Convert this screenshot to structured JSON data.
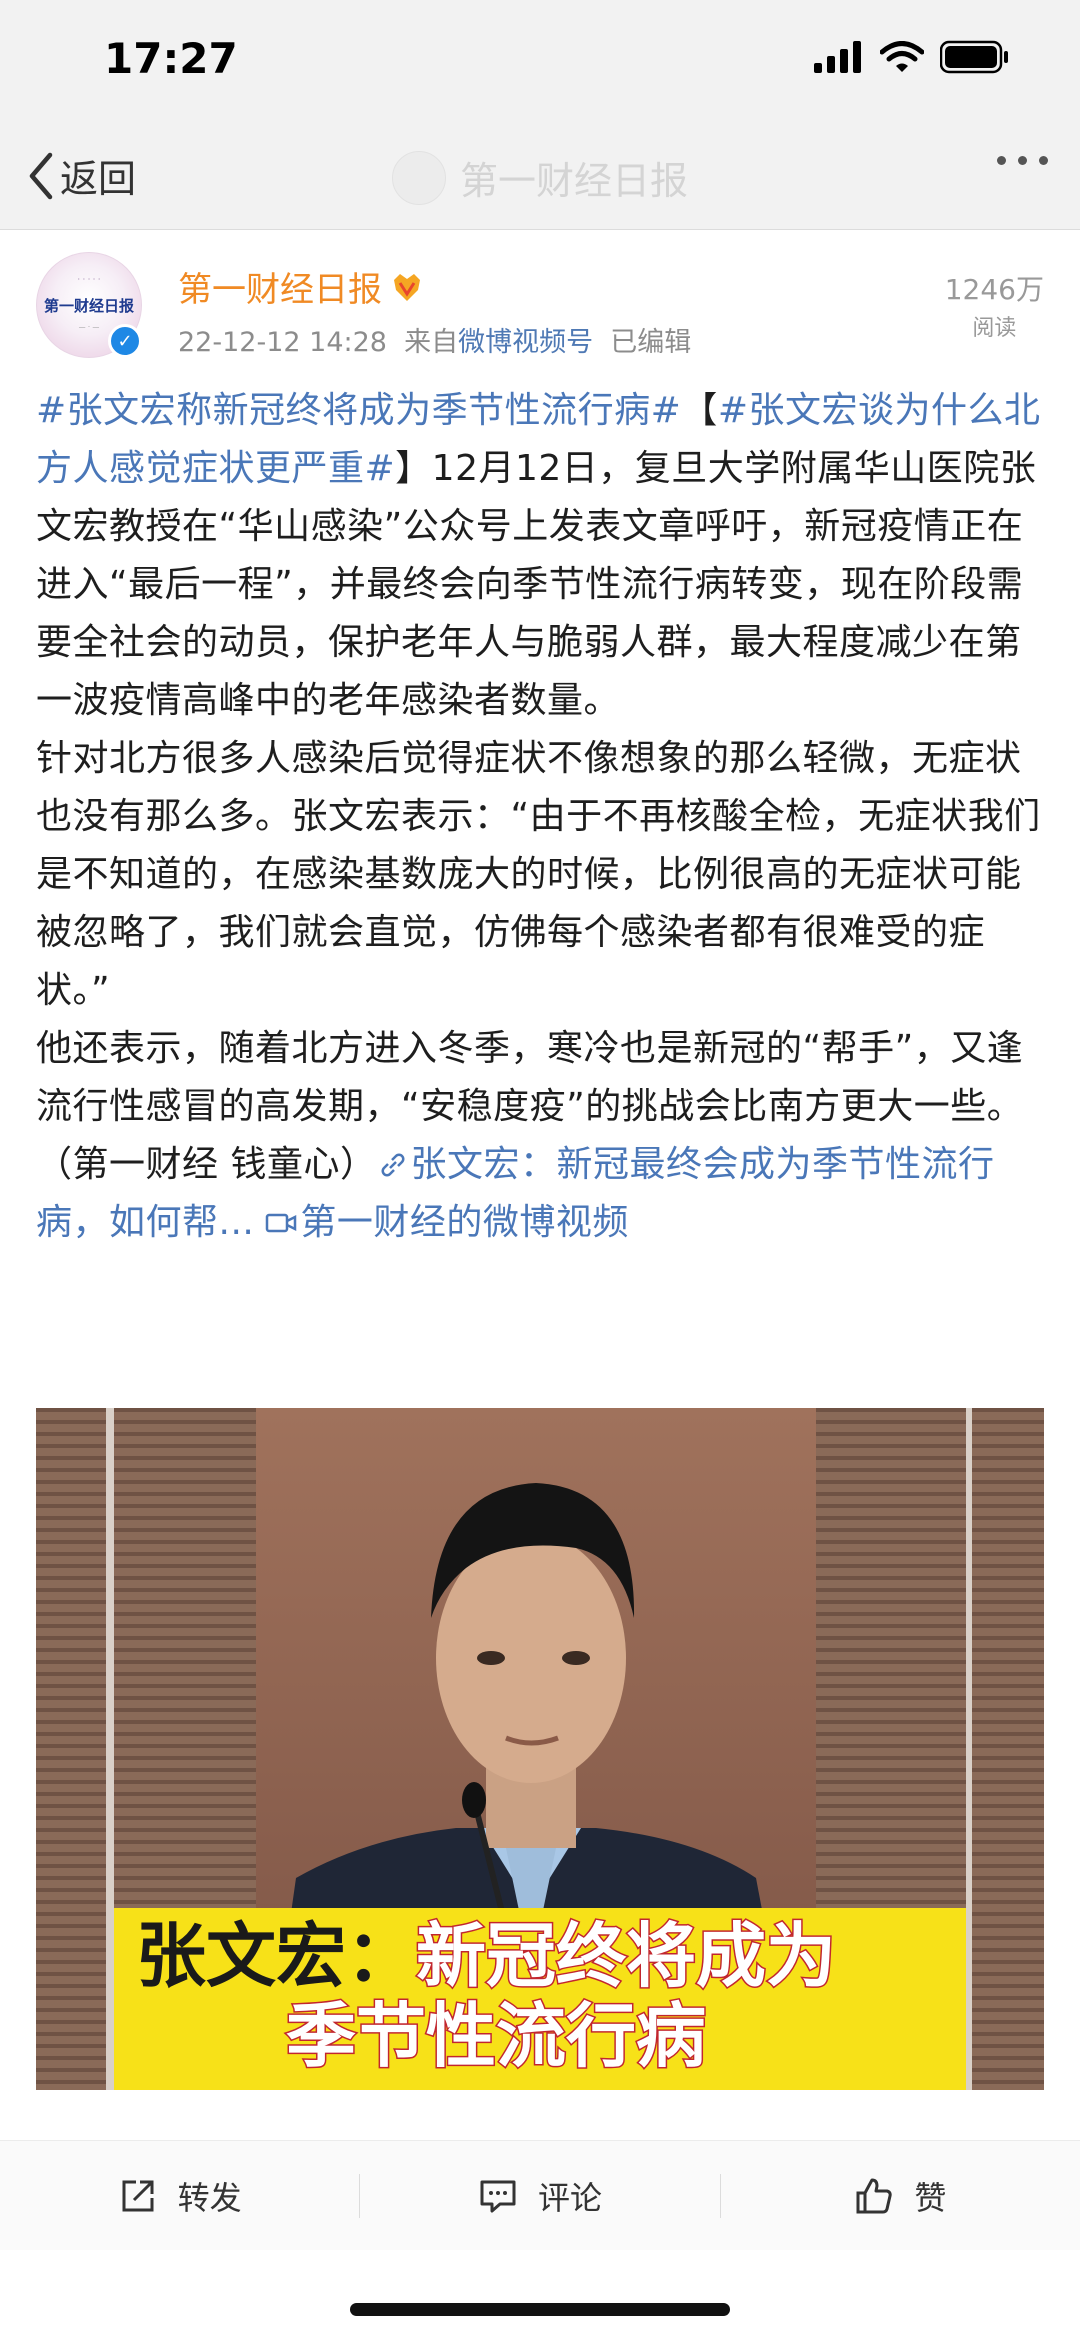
{
  "status_bar": {
    "time": "17:27"
  },
  "nav": {
    "back_label": "返回",
    "title": "第一财经日报"
  },
  "post": {
    "author": "第一财经日报",
    "avatar_text": "第一财经日报",
    "timestamp": "22-12-12 14:28",
    "source_prefix": "来自",
    "source": "微博视频号",
    "edited": "已编辑",
    "read_count": "1246万",
    "read_label": "阅读",
    "paragraph1": {
      "tag1": "#张文宏称新冠终将成为季节性流行病#",
      "bracket_open": "【",
      "tag2": "#张文宏谈为什么北方人感觉症状更严重#",
      "text": "】12月12日，复旦大学附属华山医院张文宏教授在“华山感染”公众号上发表文章呼吁，新冠疫情正在进入“最后一程”，并最终会向季节性流行病转变，现在阶段需要全社会的动员，保护老年人与脆弱人群，最大程度减少在第一波疫情高峰中的老年感染者数量。"
    },
    "paragraph2": "针对北方很多人感染后觉得症状不像想象的那么轻微，无症状也没有那么多。张文宏表示：“由于不再核酸全检，无症状我们是不知道的，在感染基数庞大的时候，比例很高的无症状可能被忽略了，我们就会直觉，仿佛每个感染者都有很难受的症状。”",
    "paragraph3": {
      "text": "他还表示，随着北方进入冬季，寒冷也是新冠的“帮手”，又逢流行性感冒的高发期，“安稳度疫”的挑战会比南方更大一些。（第一财经 钱童心）",
      "article_link": "张文宏：新冠最终会成为季节性流行病，如何帮...",
      "video_link": "第一财经的微博视频"
    },
    "video": {
      "caption_name": "张文宏：",
      "caption_line1": "新冠终将成为",
      "caption_line2": "季节性流行病"
    }
  },
  "actions": {
    "repost": "转发",
    "comment": "评论",
    "like": "赞"
  },
  "colors": {
    "author": "#f08a24",
    "link": "#4a77b8",
    "caption_bg": "#f7e118",
    "caption_name": "#1a1a1a",
    "caption_text": "#ffffff"
  }
}
